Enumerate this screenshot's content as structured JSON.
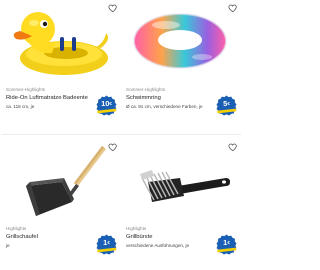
{
  "products": [
    {
      "tag": "Sommer-Highlights",
      "title": "Ride-On Luftmatratze Badeente",
      "subtitle": "ca. 118 cm, je",
      "price_main": "10",
      "price_suffix": "€",
      "favorite_icon": "heart-outline-icon",
      "image_icon": "rubber-duck-float-image"
    },
    {
      "tag": "Sommer-Highlights",
      "title": "Schwimmring",
      "subtitle": "Ø ca. 91 cm, verschiedene Farben, je",
      "price_main": "5",
      "price_suffix": "€",
      "favorite_icon": "heart-outline-icon",
      "image_icon": "swim-ring-image"
    },
    {
      "tag": "Highlights",
      "title": "Grillschaufel",
      "subtitle": "je",
      "price_main": "1",
      "price_suffix": "€",
      "favorite_icon": "heart-outline-icon",
      "image_icon": "grill-shovel-image"
    },
    {
      "tag": "Highlights",
      "title": "Grillbürste",
      "subtitle": "verschiedene Ausführungen, je",
      "price_main": "1",
      "price_suffix": "€",
      "favorite_icon": "heart-outline-icon",
      "image_icon": "grill-brush-image"
    }
  ],
  "colors": {
    "badge_blue": "#1a5fb4",
    "badge_yellow": "#f5d000",
    "heart_stroke": "#555555"
  }
}
